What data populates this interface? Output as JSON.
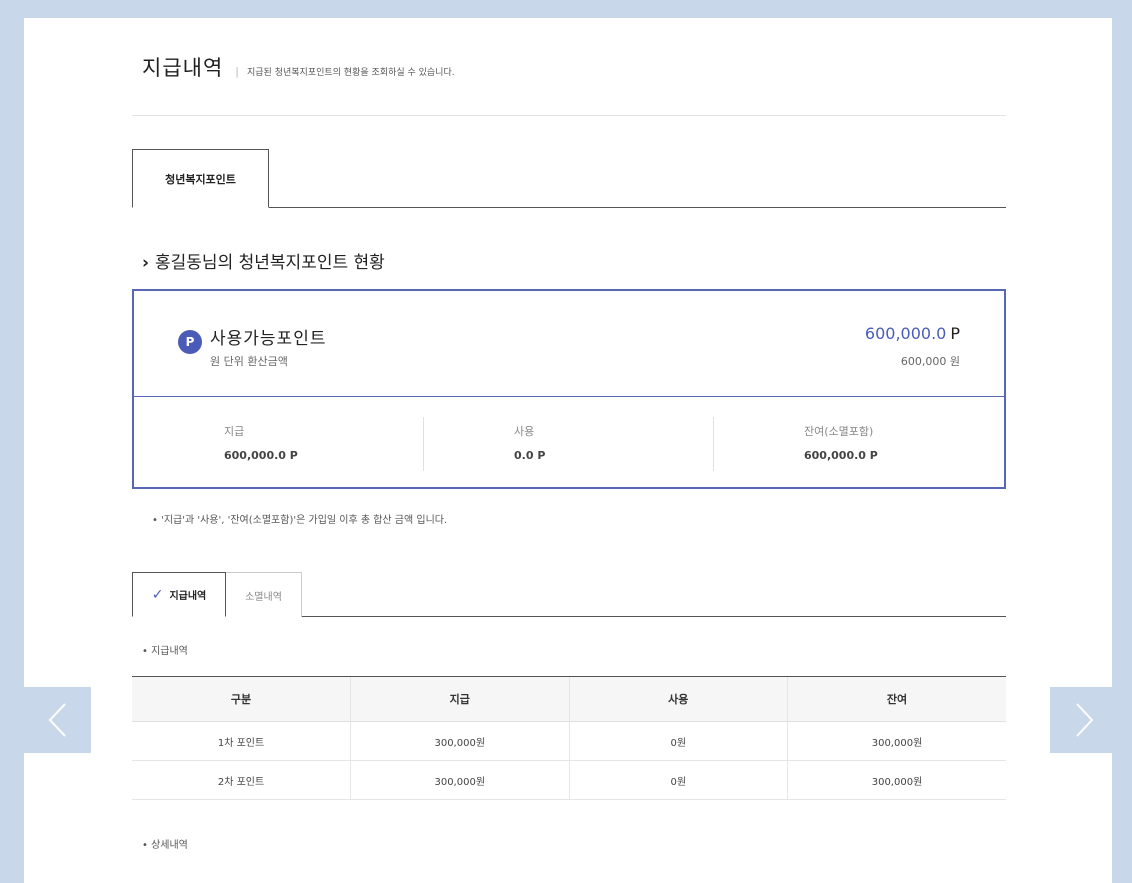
{
  "header": {
    "title": "지급내역",
    "separator": "|",
    "description": "지급된 청년복지포인트의 현황을 조회하실 수 있습니다."
  },
  "main_tab": {
    "label": "청년복지포인트"
  },
  "section": {
    "chevron": "›",
    "heading": "홍길동님의 청년복지포인트 현황"
  },
  "points": {
    "badge": "P",
    "available_label": "사용가능포인트",
    "available_value": "600,000.0",
    "available_unit": "P",
    "won_label": "원 단위 환산금액",
    "won_value": "600,000 원",
    "stats": [
      {
        "label": "지급",
        "value": "600,000.0 P"
      },
      {
        "label": "사용",
        "value": "0.0 P"
      },
      {
        "label": "잔여(소멸포함)",
        "value": "600,000.0 P"
      }
    ]
  },
  "note": "• '지급'과 '사용', '잔여(소멸포함)'은 가입일 이후 총 합산 금액 입니다.",
  "sub_tabs": [
    {
      "label": "지급내역",
      "active": true
    },
    {
      "label": "소멸내역",
      "active": false
    }
  ],
  "list_title": "• 지급내역",
  "table": {
    "headers": [
      "구분",
      "지급",
      "사용",
      "잔여"
    ],
    "rows": [
      [
        "1차 포인트",
        "300,000원",
        "0원",
        "300,000원"
      ],
      [
        "2차 포인트",
        "300,000원",
        "0원",
        "300,000원"
      ]
    ]
  },
  "detail_title": "• 상세내역",
  "icons": {
    "prev": "chevron-left-icon",
    "next": "chevron-right-icon",
    "check": "check-icon"
  },
  "colors": {
    "accent": "#4b5cb8",
    "background": "#c8d7ea"
  }
}
